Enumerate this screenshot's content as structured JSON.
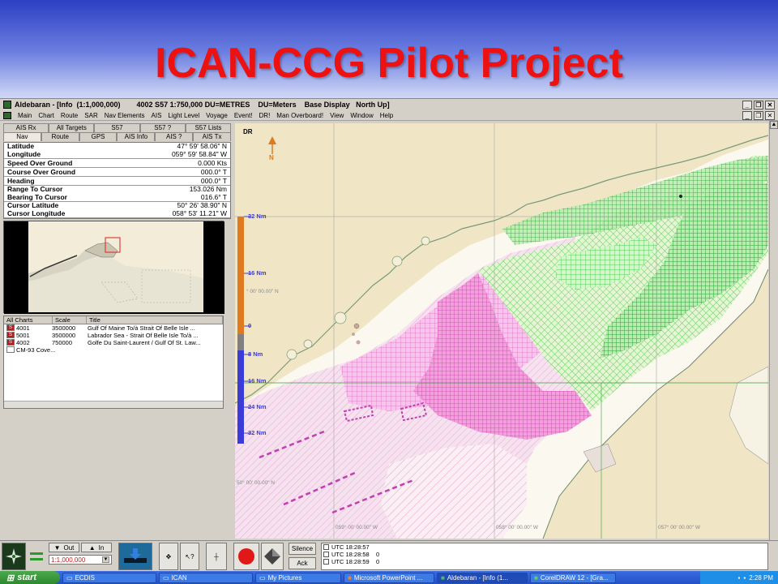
{
  "slide_title": "ICAN-CCG Pilot Project",
  "window": {
    "title": "Aldebaran - [Info  (1:1,000,000)        4002 S57 1:750,000 DU=METRES    DU=Meters    Base Display   North Up]"
  },
  "menu": [
    "Main",
    "Chart",
    "Route",
    "SAR",
    "Nav Elements",
    "AIS",
    "Light Level",
    "Voyage",
    "Event!",
    "DR!",
    "Man Overboard!",
    "View",
    "Window",
    "Help"
  ],
  "tabs_row1": [
    "AIS Rx",
    "All Targets",
    "S57",
    "S57 ?",
    "S57 Lists"
  ],
  "tabs_row2": [
    "Nav",
    "Route",
    "GPS",
    "AIS Info",
    "AIS ?",
    "AIS Tx"
  ],
  "info": {
    "lat_lon_label": "Latitude\nLongitude",
    "lat_lon_value": "47° 59' 58.06\" N\n059° 59' 58.84\" W",
    "sog_label": "Speed Over Ground",
    "sog_value": "0.000 Kts",
    "cog_label": "Course Over Ground",
    "cog_value": "000.0° T",
    "heading_label": "Heading",
    "heading_value": "000.0° T",
    "range_label": "Range To Cursor\nBearing To Cursor",
    "range_value": "153.026 Nm\n016.6° T",
    "cursor_label": "Cursor Latitude\nCursor Longitude",
    "cursor_value": "50° 26' 38.90\" N\n058° 53' 11.21\" W"
  },
  "chart_list": {
    "headers": [
      "All Charts",
      "Scale",
      "Title"
    ],
    "rows": [
      {
        "status": "S",
        "chart": "4001",
        "scale": "3500000",
        "title": "Gulf Of Maine To/à Strait Of Belle Isle ..."
      },
      {
        "status": "S",
        "chart": "5001",
        "scale": "3500000",
        "title": "Labrador Sea - Strait Of Belle Isle To/à ..."
      },
      {
        "status": "S",
        "chart": "4002",
        "scale": "750000",
        "title": "Golfe Du Saint-Laurent / Gulf Of St. Law..."
      },
      {
        "status": "",
        "chart": "CM-93 Cove...",
        "scale": "",
        "title": ""
      }
    ]
  },
  "map": {
    "mode_label": "DR",
    "north_label": "N",
    "scale_labels": [
      "32 Nm",
      "16 Nm",
      "0",
      "8 Nm",
      "16 Nm",
      "24 Nm",
      "32 Nm"
    ],
    "lat_label_1": "° 00' 00.00\" N",
    "lat_label_2": "50° 00' 00.00\" N",
    "lon_labels": [
      "059° 00' 00.00\" W",
      "058° 00' 00.00\" W",
      "057° 00' 00.00\" W"
    ]
  },
  "toolbar": {
    "out_label": "Out",
    "in_label": "In",
    "scale_value": "1:1,000,000",
    "silence_label": "Silence",
    "ack_label": "Ack",
    "log": [
      "UTC 18:28:57",
      "UTC 18:28:58    0",
      "UTC 18:28:59    0"
    ]
  },
  "taskbar": {
    "start_label": "start",
    "tasks": [
      "ECDIS",
      "ICAN",
      "My Pictures",
      "Microsoft PowerPoint ...",
      "Aldebaran - [Info  (1...",
      "CorelDRAW 12 - [Gra..."
    ],
    "clock": "2:28 PM"
  },
  "colors": {
    "title_red": "#ee1111",
    "land": "#f0e6c6",
    "pink_zone": "#f0a0e0",
    "green_zone": "#3fd44a",
    "scale_orange": "#e07a20",
    "scale_blue": "#3b3bd8"
  }
}
